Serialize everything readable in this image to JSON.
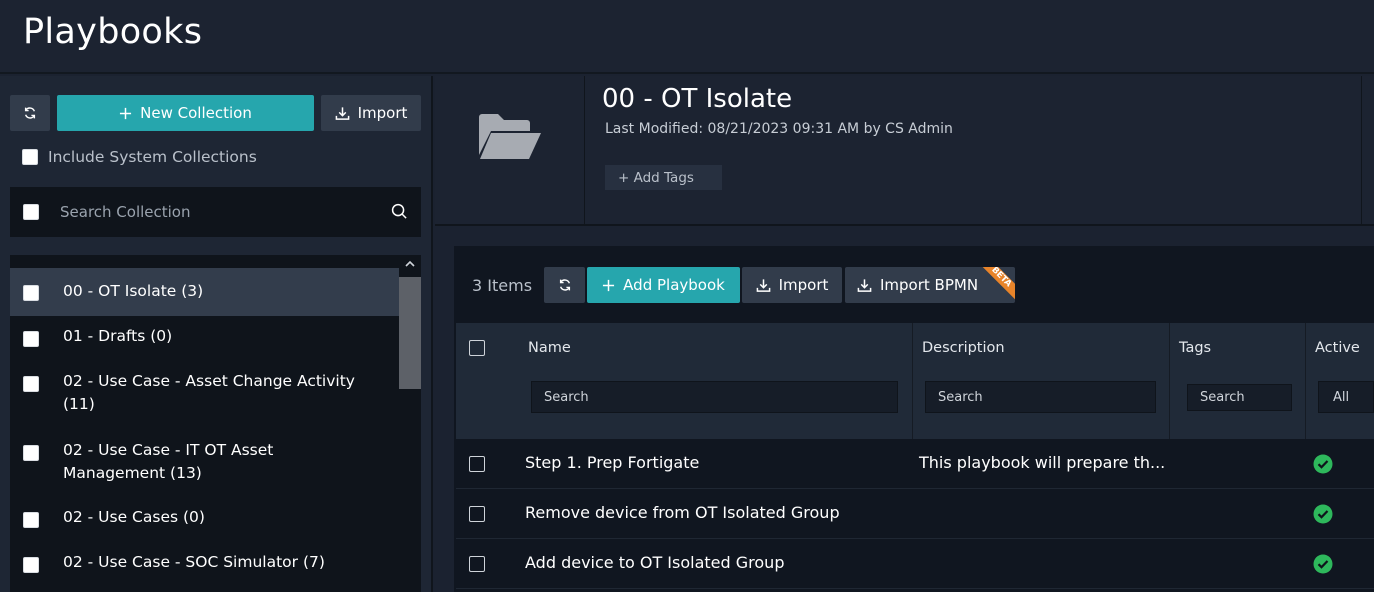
{
  "header": {
    "title": "Playbooks"
  },
  "left": {
    "new_collection_label": "New Collection",
    "import_label": "Import",
    "include_system_label": "Include System Collections",
    "search_placeholder": "Search Collection",
    "collections": [
      {
        "label": "00 - OT Isolate (3)",
        "selected": true
      },
      {
        "label": "01 - Drafts (0)"
      },
      {
        "label": "02 - Use Case - Asset Change Activity (11)"
      },
      {
        "label": "02 - Use Case - IT OT Asset Management (13)"
      },
      {
        "label": "02 - Use Cases (0)"
      },
      {
        "label": "02 - Use Case - SOC Simulator (7)"
      }
    ]
  },
  "collection": {
    "title": "00 - OT Isolate",
    "modified": "Last Modified: 08/21/2023 09:31 AM by CS Admin",
    "add_tags_label": "+ Add Tags"
  },
  "grid": {
    "items_count": "3 Items",
    "add_playbook_label": "Add Playbook",
    "import_label": "Import",
    "import_bpmn_label": "Import BPMN",
    "beta_label": "BETA",
    "columns": {
      "name": "Name",
      "description": "Description",
      "tags": "Tags",
      "active": "Active"
    },
    "filters": {
      "name_placeholder": "Search",
      "description_placeholder": "Search",
      "tags_placeholder": "Search",
      "active_value": "All"
    },
    "rows": [
      {
        "name": "Step 1. Prep Fortigate",
        "description": "This playbook will prepare th...",
        "active": true
      },
      {
        "name": "Remove device from OT Isolated Group",
        "description": "",
        "active": true
      },
      {
        "name": "Add device to OT Isolated Group",
        "description": "",
        "active": true
      }
    ]
  },
  "colors": {
    "accent": "#26a6ad",
    "active_check": "#2eb85c",
    "beta": "#e8842a"
  }
}
